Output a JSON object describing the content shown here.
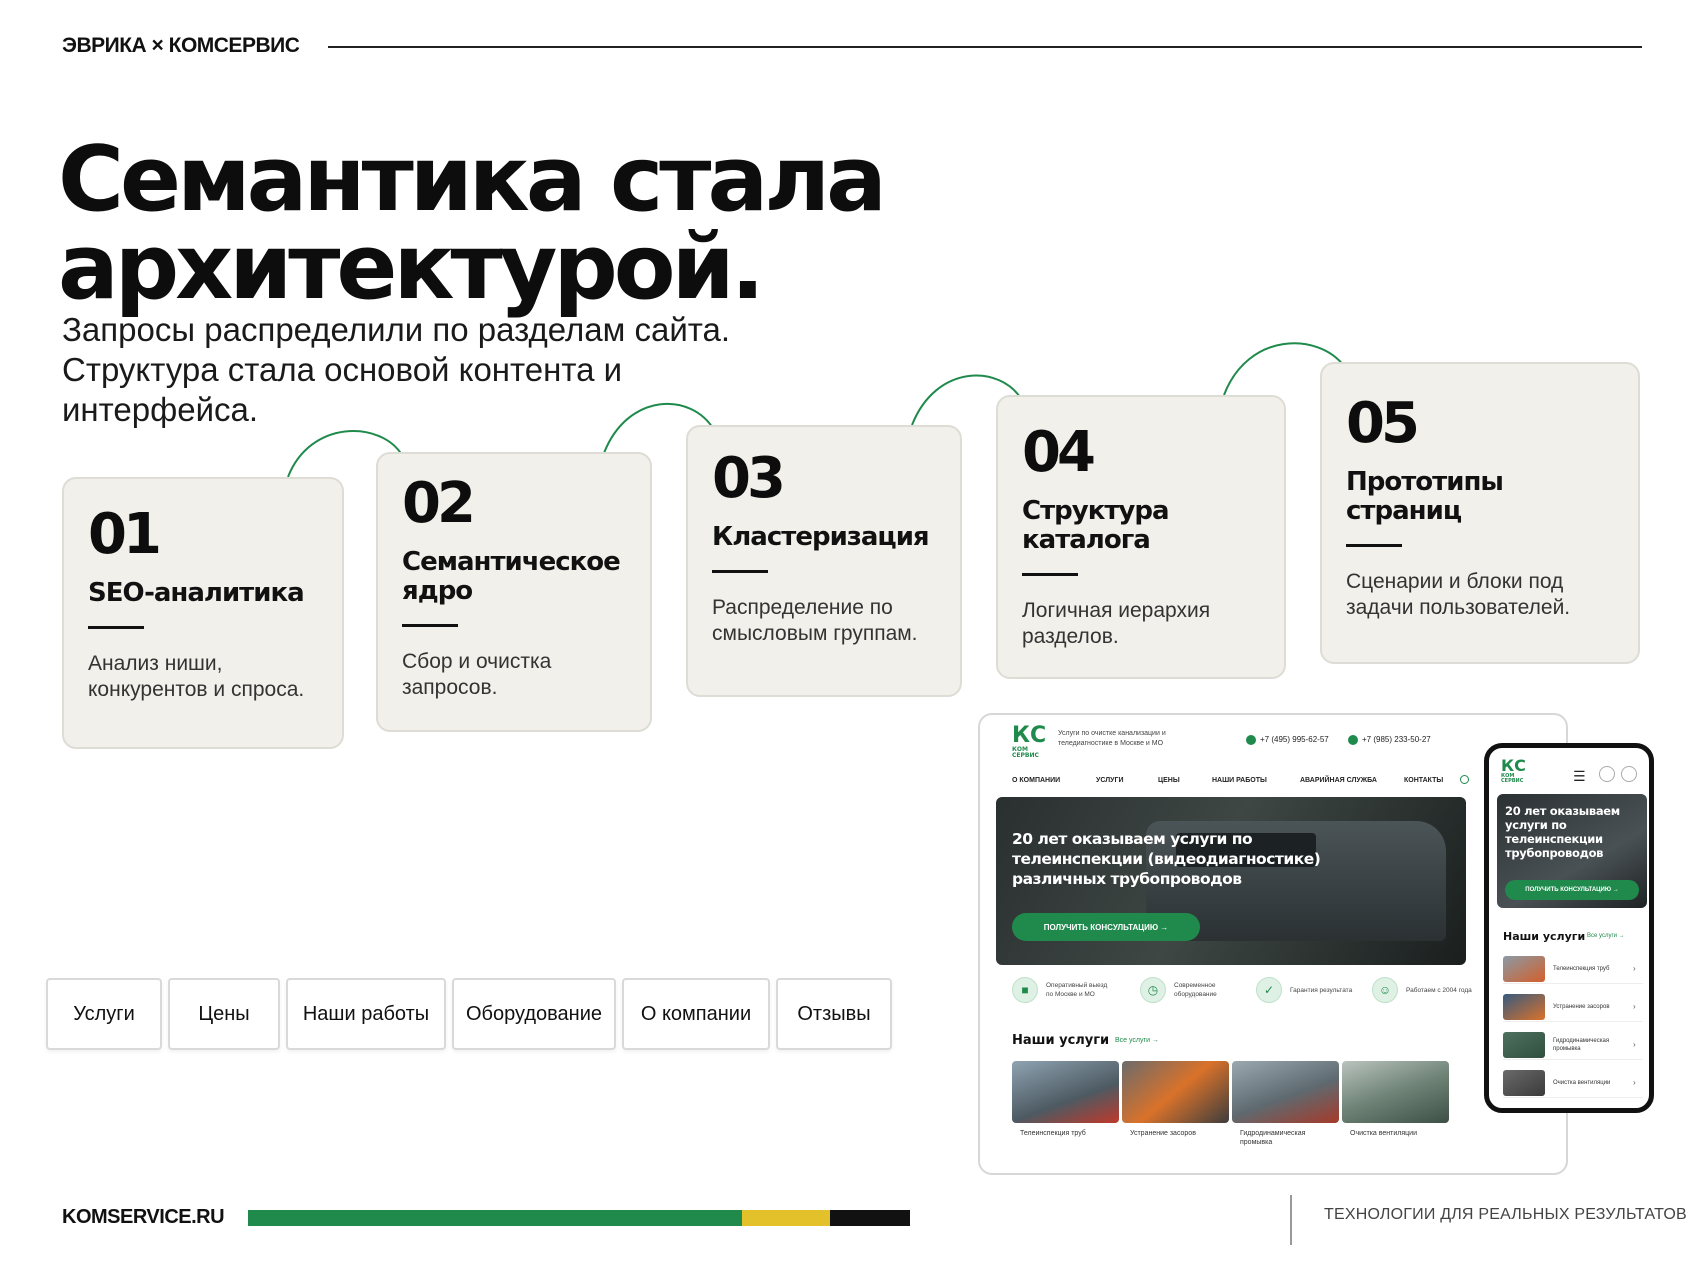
{
  "header": {
    "brand": "ЭВРИКА × КОМСЕРВИС"
  },
  "headline": {
    "line1": "Семантика стала",
    "line2": "архитектурой."
  },
  "subtext": {
    "line1": "Запросы распределили по разделам сайта.",
    "line2": "Структура стала основой контента и",
    "line3": "интерфейса."
  },
  "steps": [
    {
      "num": "01",
      "title": "SEO-аналитика",
      "desc": "Анализ ниши, конкурентов и спроса."
    },
    {
      "num": "02",
      "title": "Семантическое ядро",
      "desc": "Сбор и очистка запросов."
    },
    {
      "num": "03",
      "title": "Кластеризация",
      "desc": "Распределение по смысловым группам."
    },
    {
      "num": "04",
      "title": "Структура каталога",
      "desc": "Логичная иерархия разделов."
    },
    {
      "num": "05",
      "title": "Прототипы страниц",
      "desc": "Сценарии и блоки под задачи пользователей."
    }
  ],
  "chips": [
    "Услуги",
    "Цены",
    "Наши работы",
    "Оборудование",
    "О компании",
    "Отзывы"
  ],
  "footer": {
    "site": "KOMSERVICE.RU",
    "slogan": "ТЕХНОЛОГИИ ДЛЯ РЕАЛЬНЫХ РЕЗУЛЬТАТОВ"
  },
  "colors": {
    "green": "#1f8a4c",
    "yellow": "#e3c12b",
    "black": "#111111",
    "card": "#f1f0ea"
  },
  "mockup": {
    "logo": "КС",
    "logo_sub": "КОМ СЕРВИС",
    "tagline": "Услуги по очистке канализации и теледиагностике в Москве и МО",
    "phone1": "+7 (495) 995-62-57",
    "phone2": "+7 (985) 233-50-27",
    "nav": [
      "О КОМПАНИИ",
      "УСЛУГИ",
      "ЦЕНЫ",
      "НАШИ РАБОТЫ",
      "АВАРИЙНАЯ СЛУЖБА",
      "КОНТАКТЫ"
    ],
    "hero_title": "20 лет оказываем услуги по телеинспекции (видеодиагностике) различных трубопроводов",
    "hero_button": "ПОЛУЧИТЬ КОНСУЛЬТАЦИЮ →",
    "features": [
      "Оперативный выезд по Москве и МО",
      "Современное оборудование",
      "Гарантия результата",
      "Работаем с 2004 года"
    ],
    "services_title": "Наши услуги",
    "services_all": "Все услуги →",
    "services": [
      "Телеинспекция труб",
      "Устранение засоров",
      "Гидродинамическая промывка",
      "Очистка вентиляции"
    ]
  },
  "phone_mockup": {
    "hero_title": "20 лет оказываем услуги по телеинспекции трубопроводов",
    "hero_button": "ПОЛУЧИТЬ КОНСУЛЬТАЦИЮ →",
    "services_title": "Наши услуги",
    "services_all": "Все услуги →",
    "services": [
      "Телеинспекция труб",
      "Устранение засоров",
      "Гидродинамическая промывка",
      "Очистка вентиляции"
    ]
  }
}
